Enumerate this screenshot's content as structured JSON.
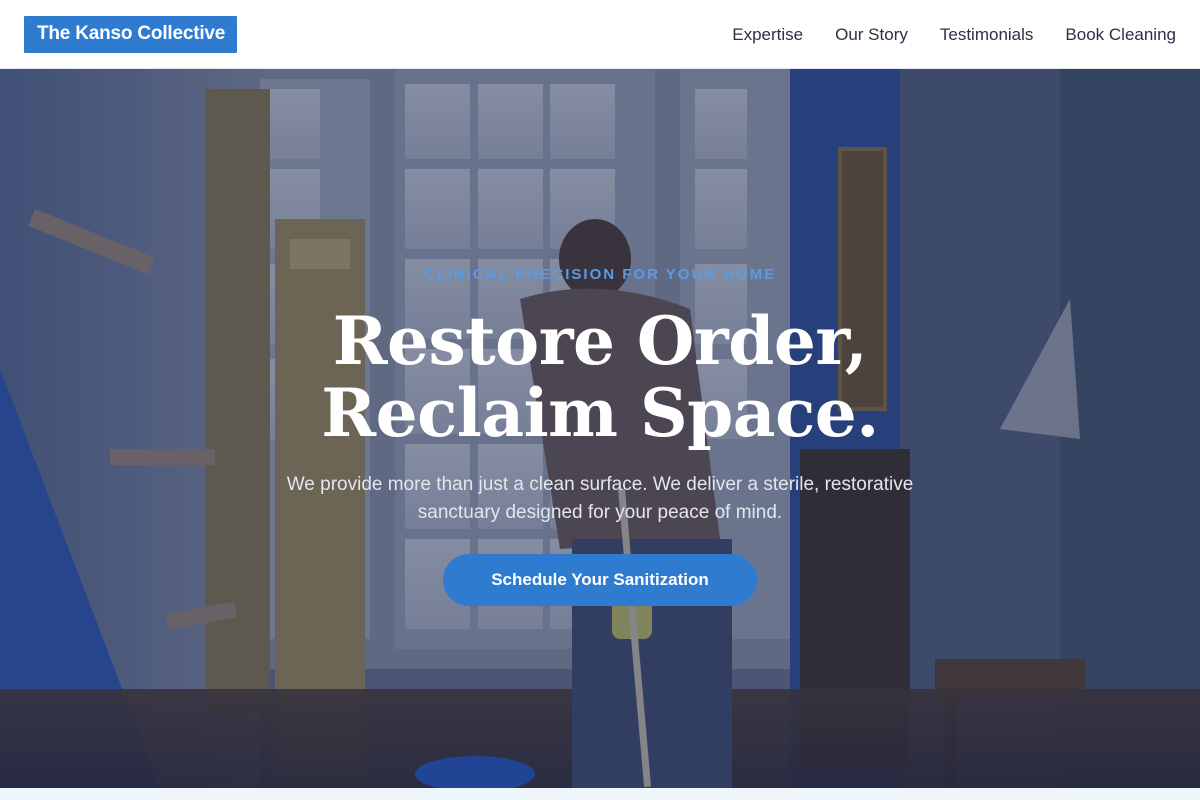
{
  "brand": {
    "name": "The Kanso Collective",
    "accent": "#2f7bd0"
  },
  "nav": {
    "items": [
      {
        "label": "Expertise"
      },
      {
        "label": "Our Story"
      },
      {
        "label": "Testimonials"
      },
      {
        "label": "Book Cleaning"
      }
    ]
  },
  "hero": {
    "eyebrow": "CLINICAL PRECISION FOR YOUR HOME",
    "headline": "Restore Order, Reclaim Space.",
    "subtext": "We provide more than just a clean surface. We deliver a sterile, restorative sanctuary designed for your peace of mind.",
    "cta_label": "Schedule Your Sanitization",
    "eyebrow_color": "#5b9be6",
    "image_description_icon": "person-mopping-hallway-photo"
  }
}
